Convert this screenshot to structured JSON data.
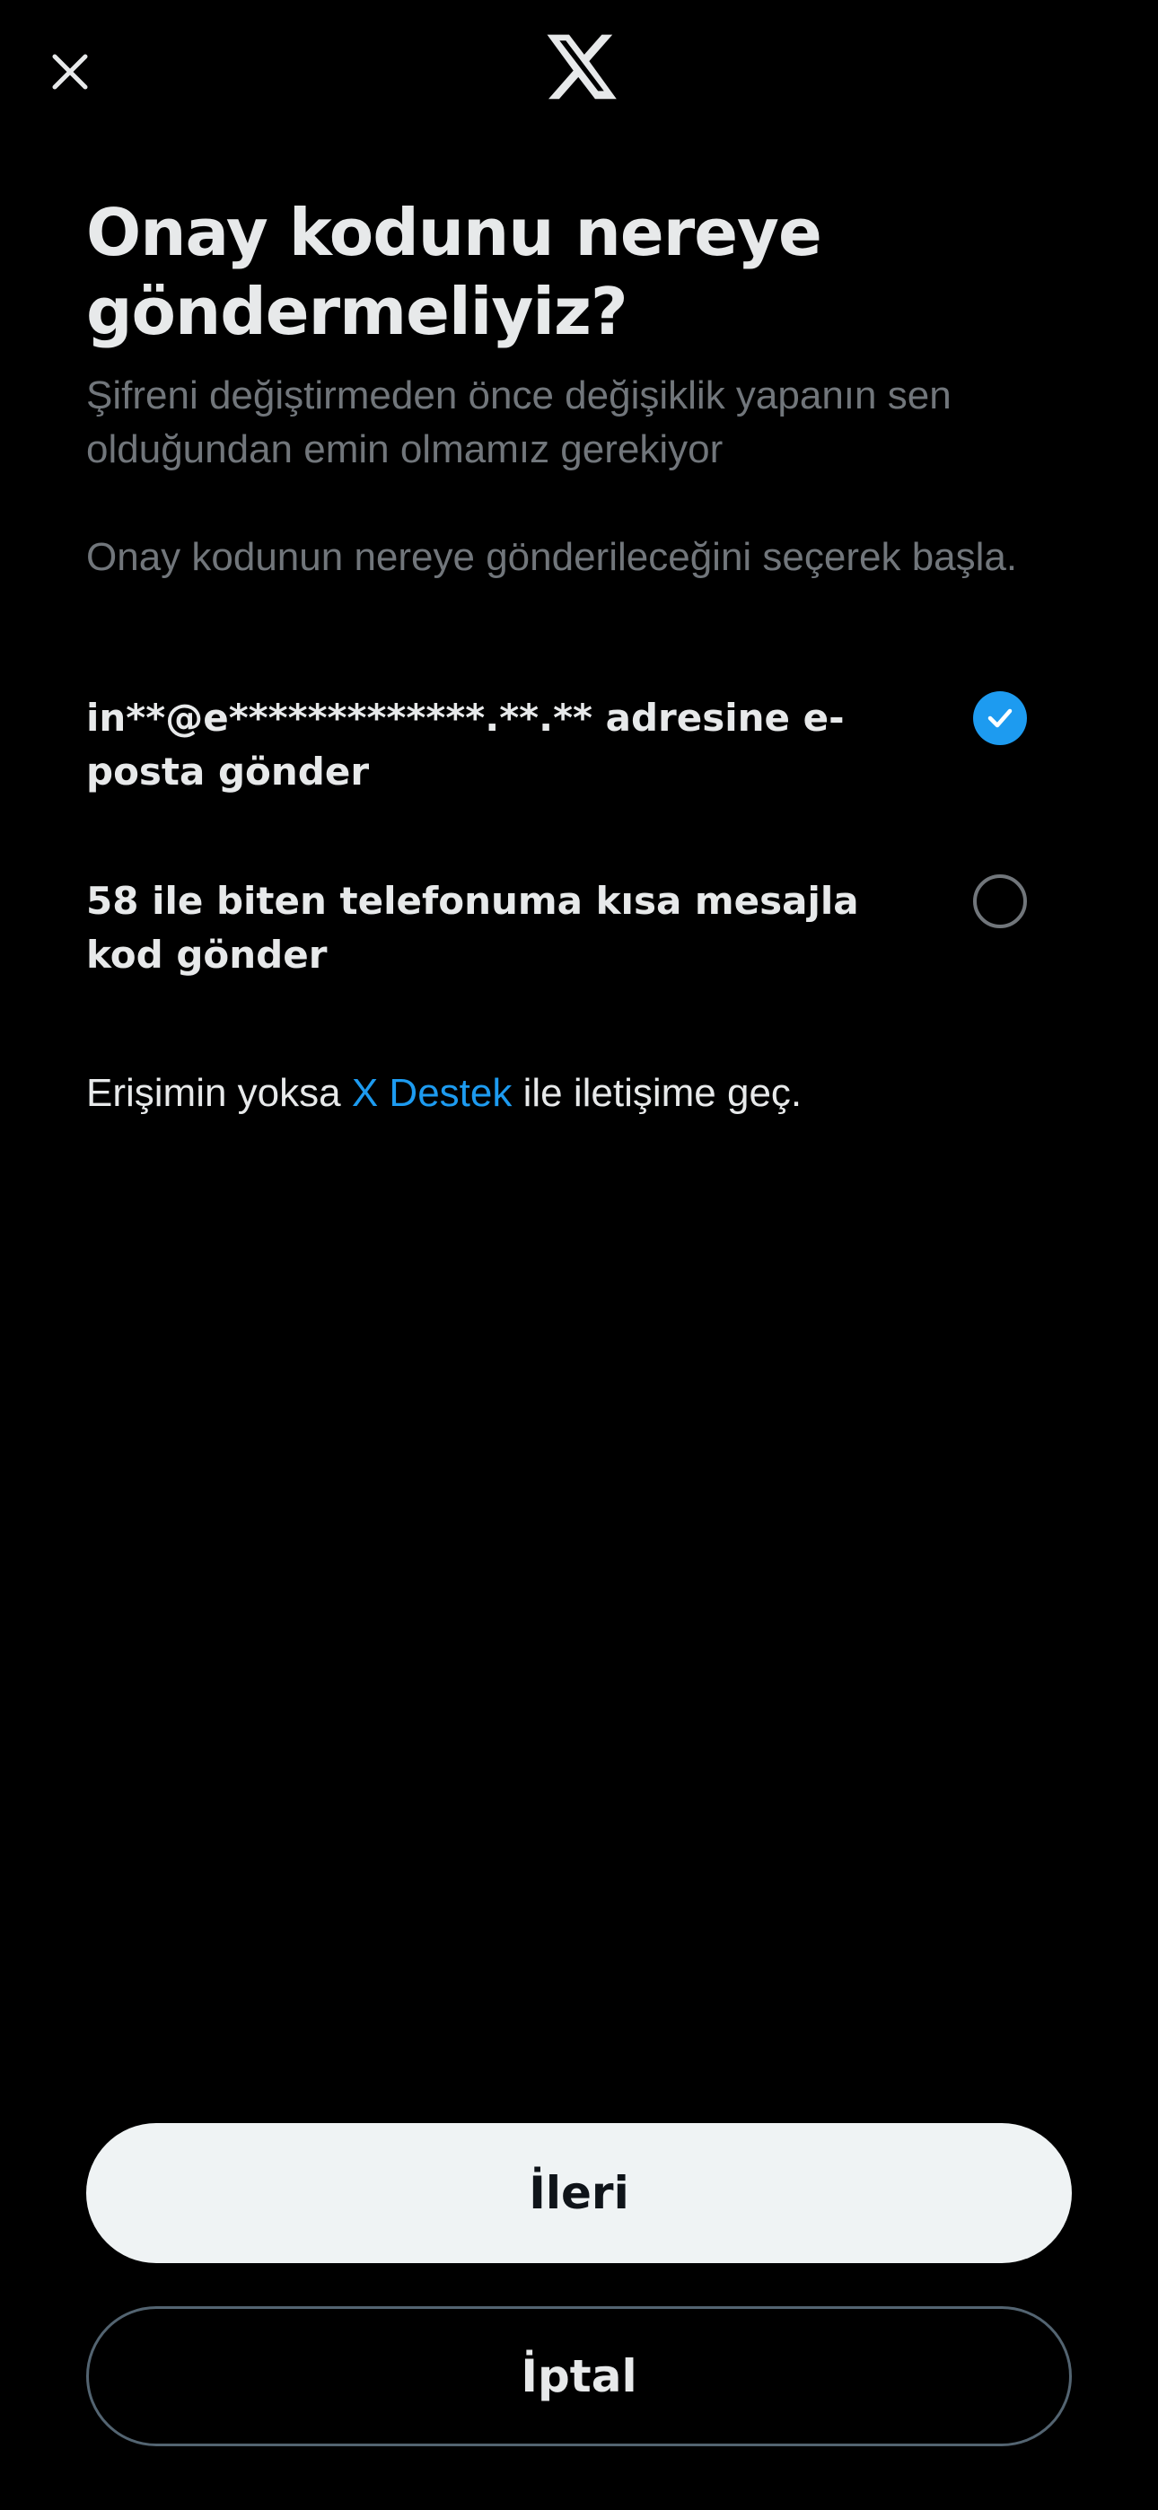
{
  "header": {
    "close_icon": "close-icon",
    "logo_icon": "x-logo-icon"
  },
  "main": {
    "title": "Onay kodunu nereye göndermeliyiz?",
    "subtitle": "Şifreni değiştirmeden önce değişiklik yapanın sen olduğundan emin olmamız gerekiyor",
    "hint": "Onay kodunun nereye gönderileceğini seçerek başla."
  },
  "options": [
    {
      "label": "in**@e*************.**.** adresine e-posta gönder",
      "selected": true
    },
    {
      "label": "58 ile biten telefonuma kısa mesajla kod gönder",
      "selected": false
    }
  ],
  "support": {
    "prefix": "Erişimin yoksa ",
    "link": "X Destek",
    "suffix": " ile iletişime geç."
  },
  "actions": {
    "next_label": "İleri",
    "cancel_label": "İptal"
  },
  "colors": {
    "background": "#000000",
    "accent": "#1d9bf0",
    "primary_text": "#e7e9ea",
    "secondary_text": "#71767b"
  }
}
